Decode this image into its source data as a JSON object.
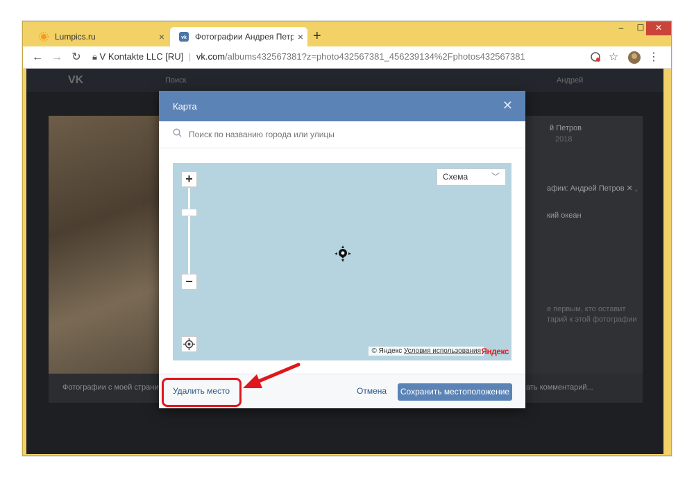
{
  "browser": {
    "tabs": [
      {
        "title": "Lumpics.ru",
        "icon": "sun-icon",
        "close": "×"
      },
      {
        "title": "Фотографии Андрея Петрова –",
        "icon": "vk-icon",
        "close": "×"
      }
    ],
    "new_tab": "+",
    "window_controls": {
      "minimize": "–",
      "maximize": "☐",
      "close": "✕"
    },
    "site_identity": "V Kontakte LLC [RU]",
    "url_host": "vk.com",
    "url_path": "/albums432567381?z=photo432567381_456239134%2Fphotos432567381"
  },
  "background_page": {
    "side_name": "й Петров",
    "side_date": "2018",
    "side_people": "афии: Андрей Петров ✕ ,",
    "side_place": "кий океан",
    "comment_hint_1": "е первым, кто оставит",
    "comment_hint_2": "тарий к этой фотографии",
    "comment_placeholder": "ать комментарий...",
    "photo_caption": "Фотографии с моей страни",
    "header_search": "Поиск",
    "header_user": "Андрей"
  },
  "modal": {
    "title": "Карта",
    "close": "✕",
    "search_placeholder": "Поиск по названию города или улицы",
    "map": {
      "zoom_in": "+",
      "zoom_out": "−",
      "map_type": "Схема",
      "attribution_brand": "© Яндекс",
      "attribution_terms": "Условия использования",
      "logo_text": "Яндекс"
    },
    "footer": {
      "delete_label": "Удалить место",
      "cancel_label": "Отмена",
      "save_label": "Сохранить местоположение"
    }
  },
  "colors": {
    "vk_blue": "#5b83b5",
    "link": "#2a5885",
    "highlight": "#e0161d",
    "map_water": "#b6d4e0",
    "window_frame": "#f2d166"
  }
}
